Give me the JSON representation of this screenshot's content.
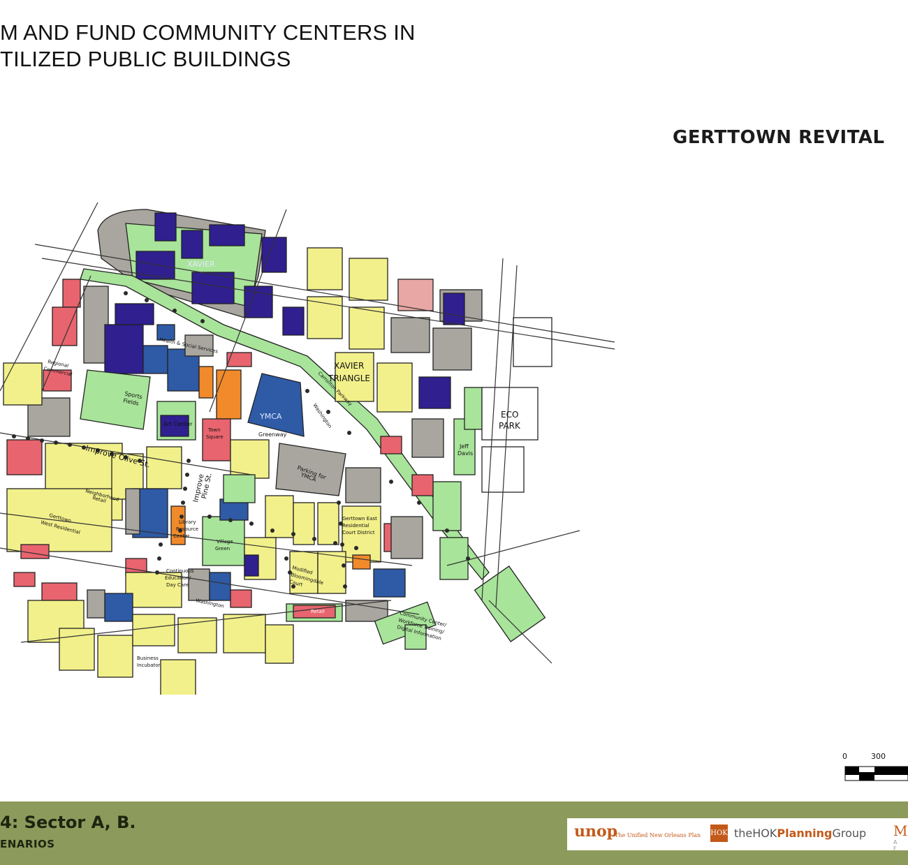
{
  "header": {
    "title_line1": "M AND FUND COMMUNITY CENTERS IN",
    "title_line2": "TILIZED PUBLIC BUILDINGS",
    "subtitle": "GERTTOWN REVITAL"
  },
  "map": {
    "labels": {
      "xavier": "XAVIER",
      "xavier_triangle_1": "XAVIER",
      "xavier_triangle_2": "TRIANGLE",
      "eco_park_1": "ECO",
      "eco_park_2": "PARK",
      "ymca": "YMCA",
      "greenway": "Greenway",
      "parking_ymca_1": "Parking for",
      "parking_ymca_2": "YMCA",
      "jeff_davis_1": "Jeff",
      "jeff_davis_2": "Davis",
      "health_social": "Health & Social Services",
      "regional_commercial_1": "Regional",
      "regional_commercial_2": "Commercial",
      "sports_fields_1": "Sports",
      "sports_fields_2": "Fields",
      "art_center": "Art Center",
      "town_square_1": "Town",
      "town_square_2": "Square",
      "improve_olive": "Improve Olive St.",
      "improve_pine_1": "Improve",
      "improve_pine_2": "Pine St.",
      "neighborhood_retail_1": "Neighborhood",
      "neighborhood_retail_2": "Retail",
      "gerttown_west_1": "Gerttown",
      "gerttown_west_2": "West Residential",
      "library_1": "Library",
      "library_2": "Resource",
      "library_3": "Center",
      "village_green_1": "Village",
      "village_green_2": "Green",
      "gerttown_east_1": "Gerttown East",
      "gerttown_east_2": "Residential",
      "gerttown_east_3": "Court District",
      "modified_bloomingdale_1": "Modified",
      "modified_bloomingdale_2": "Bloomingdale",
      "modified_bloomingdale_3": "Court",
      "continuous_ed_1": "Continuous",
      "continuous_ed_2": "Education/",
      "continuous_ed_3": "Day Care",
      "washington_1": "Washington",
      "washington_2": "Washington",
      "retail": "Retail",
      "community_center_1": "Community Center/",
      "community_center_2": "Workforce Training/",
      "community_center_3": "Digital Information",
      "business_incubator_1": "Business",
      "business_incubator_2": "Incubator",
      "carrollton": "Carrollton Parkway"
    },
    "scale": {
      "tick0": "0",
      "tick1": "300"
    },
    "colors": {
      "residential": "#f2f08a",
      "green": "#a8e49a",
      "xavier": "#2f1f8f",
      "civic_blue": "#2e5aa6",
      "retail_red": "#e8646e",
      "orange": "#f08a2a",
      "gray": "#a9a6a0",
      "pink": "#e8a7a4"
    }
  },
  "footer": {
    "sector": "4: Sector A, B.",
    "scenarios": "ENARIOS",
    "logos": {
      "unop": "unop",
      "unop_tag": "The Unified New Orleans Plan",
      "hok_badge": "HOK",
      "hok_prefix": "theHOK",
      "hok_bold": "Planning",
      "hok_suffix": "Group",
      "ma": "Ma",
      "ma_sub": "A F"
    }
  }
}
